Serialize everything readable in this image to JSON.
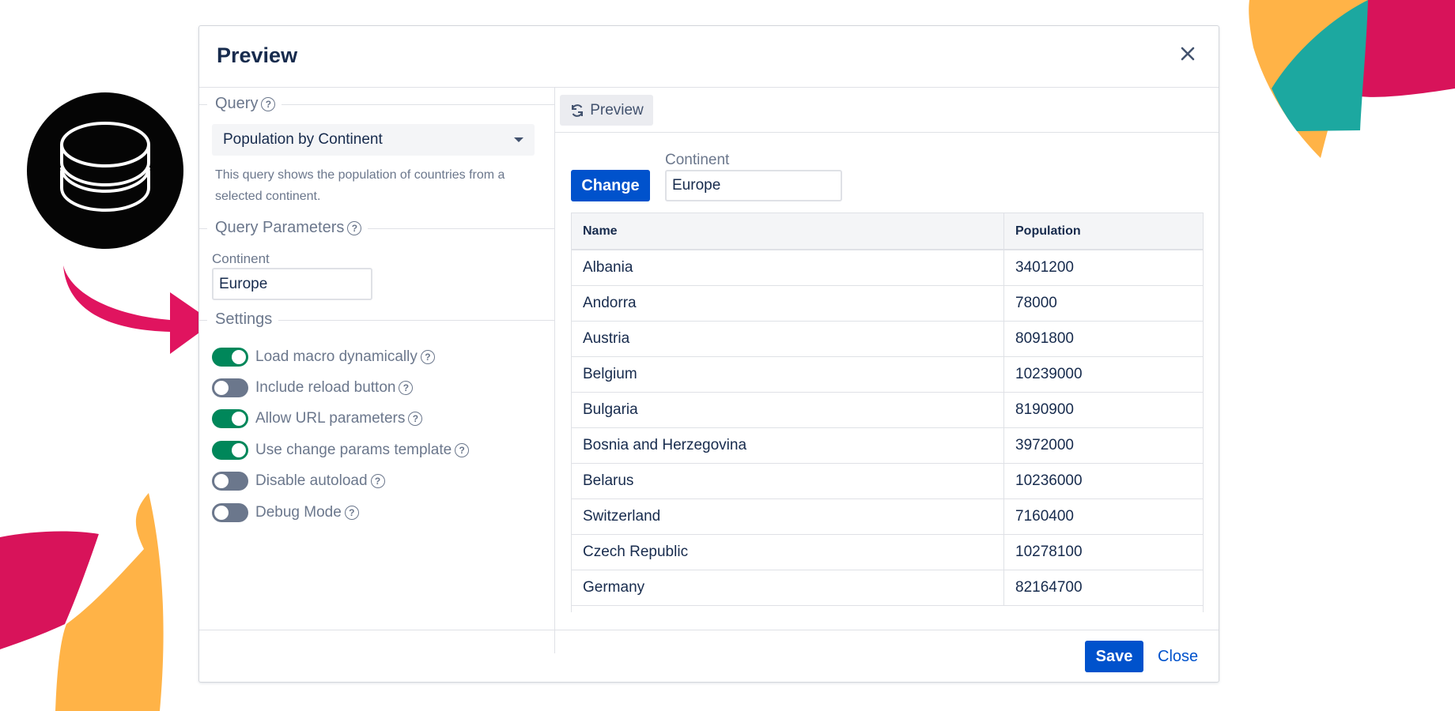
{
  "dialog": {
    "title": "Preview",
    "close_icon": "close-icon"
  },
  "left": {
    "query_legend": "Query",
    "query_select_value": "Population by Continent",
    "query_description": "This query shows the population of countries from a selected continent.",
    "params_legend": "Query Parameters",
    "continent_label": "Continent",
    "continent_value": "Europe",
    "settings_legend": "Settings",
    "settings": [
      {
        "label": "Load macro dynamically",
        "on": true,
        "help": true
      },
      {
        "label": "Include reload button",
        "on": false,
        "help": true
      },
      {
        "label": "Allow URL parameters",
        "on": true,
        "help": true
      },
      {
        "label": "Use change params template",
        "on": true,
        "help": true
      },
      {
        "label": "Disable autoload",
        "on": false,
        "help": true
      },
      {
        "label": "Debug Mode",
        "on": false,
        "help": true
      }
    ]
  },
  "right": {
    "preview_button": "Preview",
    "change_button": "Change",
    "continent_label": "Continent",
    "continent_value": "Europe",
    "table": {
      "headers": [
        "Name",
        "Population"
      ],
      "rows": [
        [
          "Albania",
          "3401200"
        ],
        [
          "Andorra",
          "78000"
        ],
        [
          "Austria",
          "8091800"
        ],
        [
          "Belgium",
          "10239000"
        ],
        [
          "Bulgaria",
          "8190900"
        ],
        [
          "Bosnia and Herzegovina",
          "3972000"
        ],
        [
          "Belarus",
          "10236000"
        ],
        [
          "Switzerland",
          "7160400"
        ],
        [
          "Czech Republic",
          "10278100"
        ],
        [
          "Germany",
          "82164700"
        ]
      ]
    }
  },
  "footer": {
    "save_button": "Save",
    "close_link": "Close"
  },
  "colors": {
    "primary": "#0052cc",
    "toggle_on": "#00875a",
    "toggle_off": "#6b778c",
    "deco_pink": "#d8135a",
    "deco_orange": "#ffb347",
    "deco_teal": "#1ca8a0"
  }
}
